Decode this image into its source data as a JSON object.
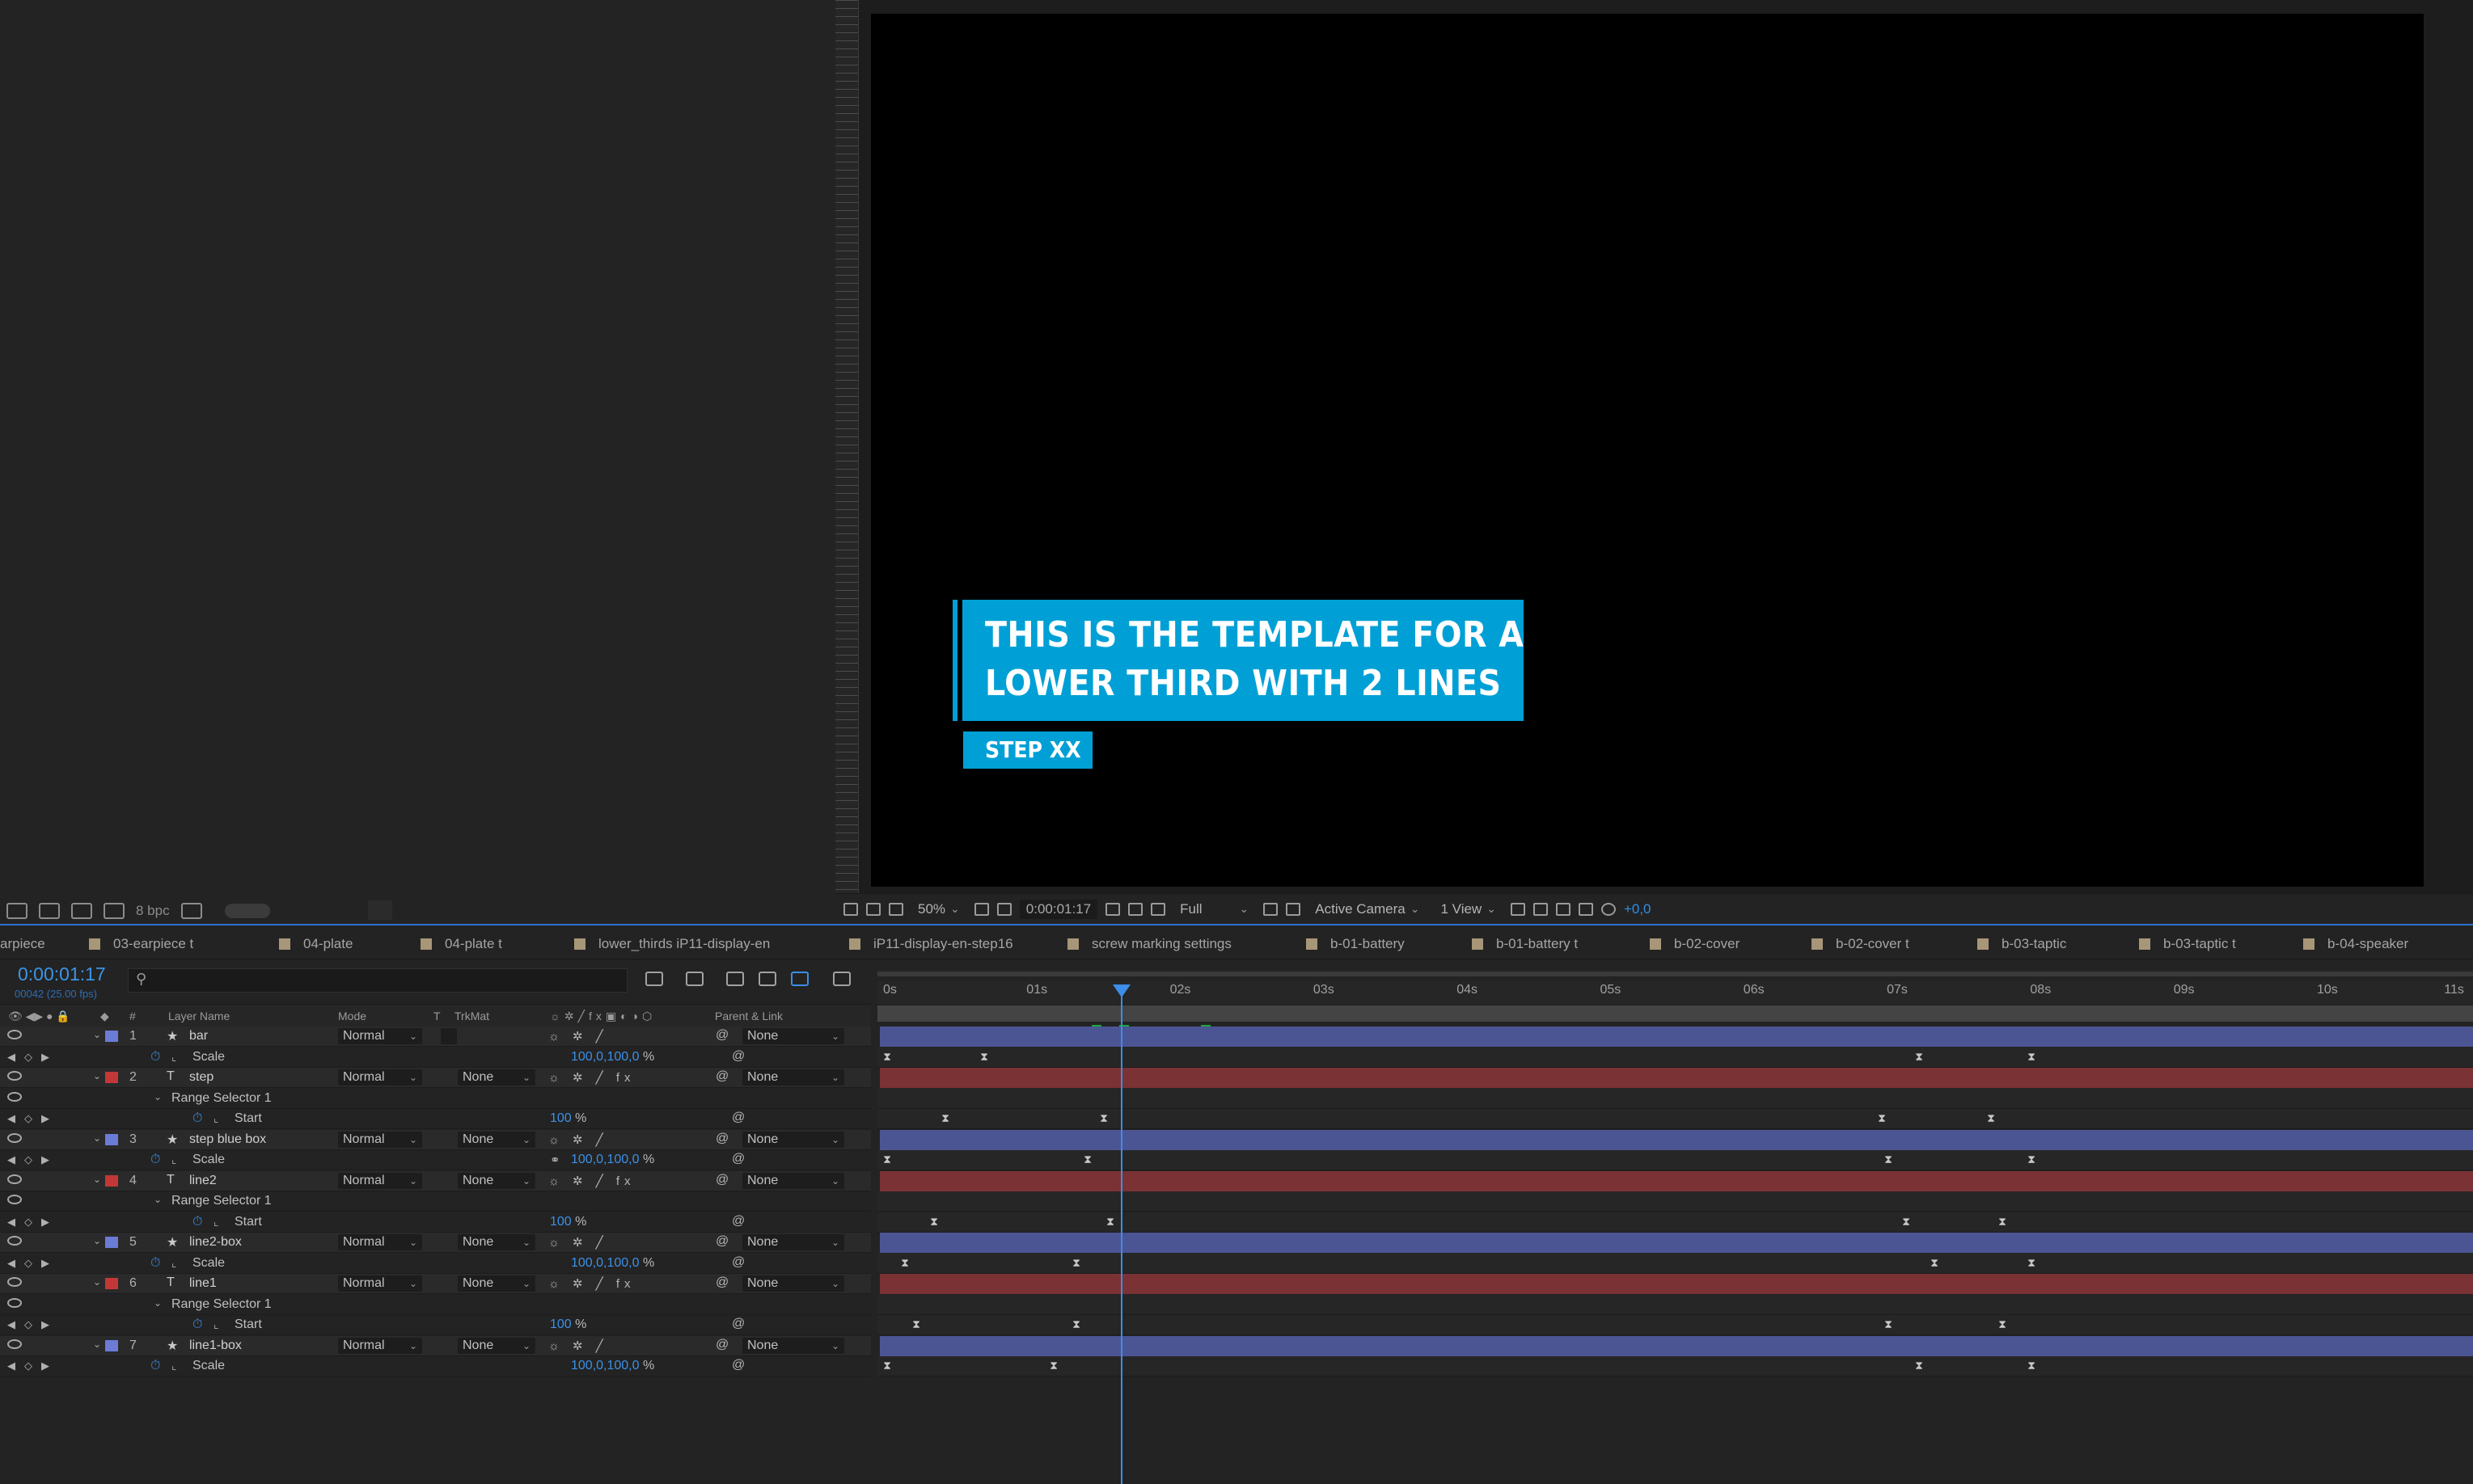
{
  "project": {
    "bpc": "8 bpc"
  },
  "comp": {
    "line1": "THIS IS THE TEMPLATE FOR A",
    "line2": "LOWER THIRD WITH 2 LINES",
    "step": "STEP XX",
    "accent": "#00a0d6"
  },
  "viewer_toolbar": {
    "zoom": "50%",
    "timecode": "0:00:01:17",
    "resolution": "Full",
    "camera": "Active Camera",
    "views": "1 View",
    "exposure": "+0,0"
  },
  "tabs": [
    "arpiece",
    "03-earpiece t",
    "04-plate",
    "04-plate t",
    "lower_thirds iP11-display-en",
    "iP11-display-en-step16",
    "screw marking settings",
    "b-01-battery",
    "b-01-battery t",
    "b-02-cover",
    "b-02-cover t",
    "b-03-taptic",
    "b-03-taptic t",
    "b-04-speaker"
  ],
  "timeline": {
    "time": "0:00:01:17",
    "fps": "00042 (25.00 fps)",
    "search_placeholder": "",
    "columns": {
      "num": "#",
      "layer_name": "Layer Name",
      "mode": "Mode",
      "t": "T",
      "trkmat": "TrkMat",
      "parent": "Parent & Link"
    },
    "ruler": [
      "0s",
      "01s",
      "02s",
      "03s",
      "04s",
      "05s",
      "06s",
      "07s",
      "08s",
      "09s",
      "10s",
      "11s"
    ],
    "rows": [
      {
        "kind": "layer",
        "num": "1",
        "type": "★",
        "name": "bar",
        "color": "#6b7bd6",
        "mode": "Normal",
        "trkmat": "",
        "parent": "None"
      },
      {
        "kind": "prop",
        "indent": 1,
        "name": "Scale",
        "value": "100,0,100,0",
        "unit": "%"
      },
      {
        "kind": "layer",
        "num": "2",
        "type": "T",
        "name": "step",
        "color": "#c23838",
        "mode": "Normal",
        "trkmat": "None",
        "parent": "None"
      },
      {
        "kind": "group",
        "name": "Range Selector 1"
      },
      {
        "kind": "prop",
        "indent": 2,
        "name": "Start",
        "value": "100",
        "unit": "%"
      },
      {
        "kind": "layer",
        "num": "3",
        "type": "★",
        "name": "step blue box",
        "color": "#6b7bd6",
        "mode": "Normal",
        "trkmat": "None",
        "parent": "None"
      },
      {
        "kind": "prop",
        "indent": 1,
        "name": "Scale",
        "value": "100,0,100,0",
        "unit": "%"
      },
      {
        "kind": "layer",
        "num": "4",
        "type": "T",
        "name": "line2",
        "color": "#c23838",
        "mode": "Normal",
        "trkmat": "None",
        "parent": "None"
      },
      {
        "kind": "group",
        "name": "Range Selector 1"
      },
      {
        "kind": "prop",
        "indent": 2,
        "name": "Start",
        "value": "100",
        "unit": "%"
      },
      {
        "kind": "layer",
        "num": "5",
        "type": "★",
        "name": "line2-box",
        "color": "#6b7bd6",
        "mode": "Normal",
        "trkmat": "None",
        "parent": "None"
      },
      {
        "kind": "prop",
        "indent": 1,
        "name": "Scale",
        "value": "100,0,100,0",
        "unit": "%"
      },
      {
        "kind": "layer",
        "num": "6",
        "type": "T",
        "name": "line1",
        "color": "#c23838",
        "mode": "Normal",
        "trkmat": "None",
        "parent": "None"
      },
      {
        "kind": "group",
        "name": "Range Selector 1"
      },
      {
        "kind": "prop",
        "indent": 2,
        "name": "Start",
        "value": "100",
        "unit": "%"
      },
      {
        "kind": "layer",
        "num": "7",
        "type": "★",
        "name": "line1-box",
        "color": "#6b7bd6",
        "mode": "Normal",
        "trkmat": "None",
        "parent": "None"
      },
      {
        "kind": "prop",
        "indent": 1,
        "name": "Scale",
        "value": "100,0,100,0",
        "unit": "%"
      }
    ]
  }
}
